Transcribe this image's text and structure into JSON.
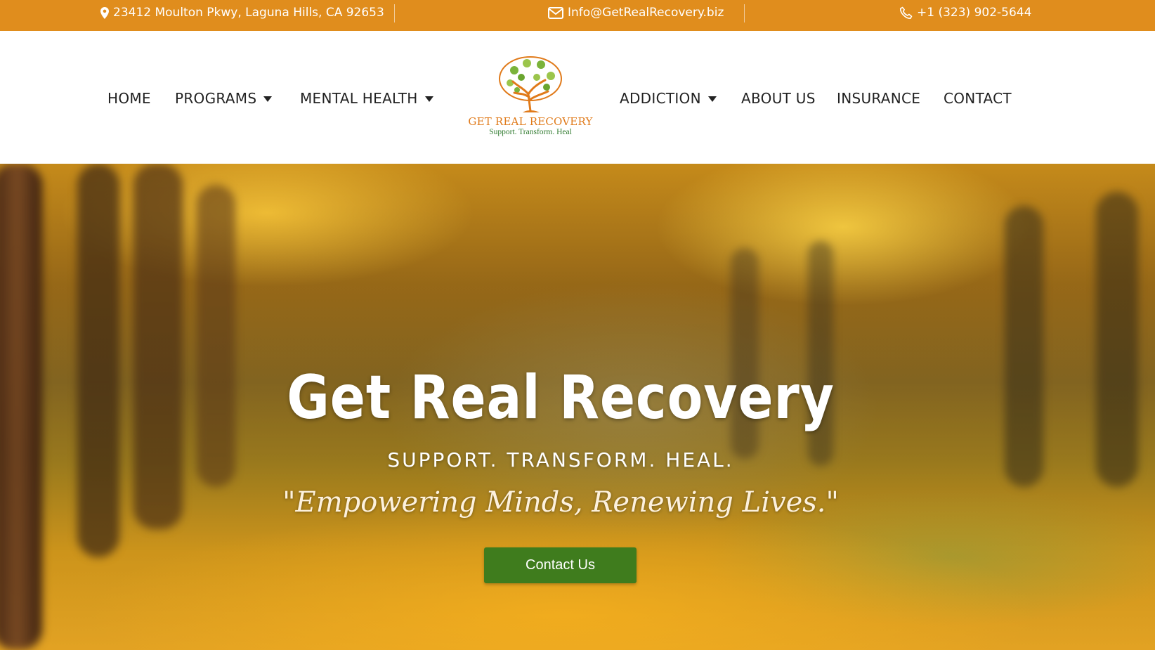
{
  "topbar": {
    "address": "23412 Moulton Pkwy, Laguna Hills, CA 92653",
    "email": "Info@GetRealRecovery.biz",
    "phone": "+1 (323) 902-5644",
    "address_icon": "map-pin-icon",
    "email_icon": "envelope-icon",
    "phone_icon": "phone-icon"
  },
  "nav": {
    "home": "HOME",
    "programs": "PROGRAMS",
    "mental_health": "MENTAL HEALTH",
    "addiction": "ADDICTION",
    "about_us": "ABOUT US",
    "insurance": "INSURANCE",
    "contact": "CONTACT"
  },
  "logo": {
    "brand": "GET REAL RECOVERY",
    "tagline": "Support. Transform. Heal"
  },
  "hero": {
    "title": "Get Real Recovery",
    "subtitle": "SUPPORT. TRANSFORM. HEAL.",
    "quote": "\"Empowering Minds, Renewing Lives.\"",
    "cta_label": "Contact Us"
  },
  "colors": {
    "topbar": "#e08d1d",
    "cta": "#3f7c1d",
    "brand_orange": "#e07a1a",
    "brand_green": "#2f7a2e"
  }
}
